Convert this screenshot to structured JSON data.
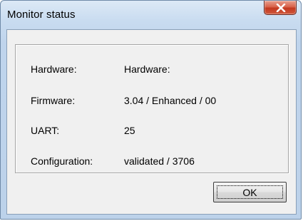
{
  "window": {
    "title": "Monitor status",
    "close_icon": "close-icon"
  },
  "status": {
    "rows": [
      {
        "label": "Hardware:",
        "value": "Hardware:"
      },
      {
        "label": "Firmware:",
        "value": "3.04 / Enhanced / 00"
      },
      {
        "label": "UART:",
        "value": "25"
      },
      {
        "label": "Configuration:",
        "value": "validated / 3706"
      }
    ]
  },
  "buttons": {
    "ok_label": "OK"
  },
  "colors": {
    "frame": "#bcd2ea",
    "client": "#f0f0f0",
    "close_button": "#c3381f"
  }
}
